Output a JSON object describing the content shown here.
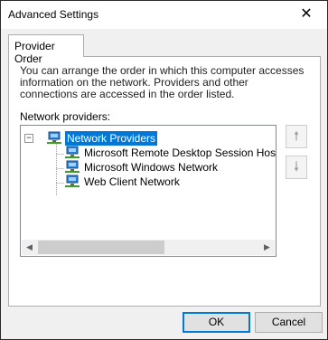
{
  "window": {
    "title": "Advanced Settings",
    "close_glyph": "✕"
  },
  "tabs": [
    {
      "label": "Provider Order"
    }
  ],
  "description": "You can arrange the order in which this computer accesses information on the network.  Providers and other connections are accessed in the order listed.",
  "network_providers_label": "Network providers:",
  "tree": {
    "root": {
      "label": "Network Providers",
      "expander": "−",
      "selected": true,
      "icon": "network-computer-icon"
    },
    "children": [
      {
        "label": "Microsoft Remote Desktop Session Host Server Network",
        "icon": "network-computer-icon"
      },
      {
        "label": "Microsoft Windows Network",
        "icon": "network-computer-icon"
      },
      {
        "label": "Web Client Network",
        "icon": "network-computer-icon"
      }
    ]
  },
  "scrollbar": {
    "left_arrow": "◀",
    "right_arrow": "▶"
  },
  "move_buttons": {
    "up_glyph": "🠕",
    "down_glyph": "🠗"
  },
  "buttons": {
    "ok": "OK",
    "cancel": "Cancel"
  },
  "colors": {
    "selection": "#0078d7",
    "default_button_border": "#0078d7"
  }
}
